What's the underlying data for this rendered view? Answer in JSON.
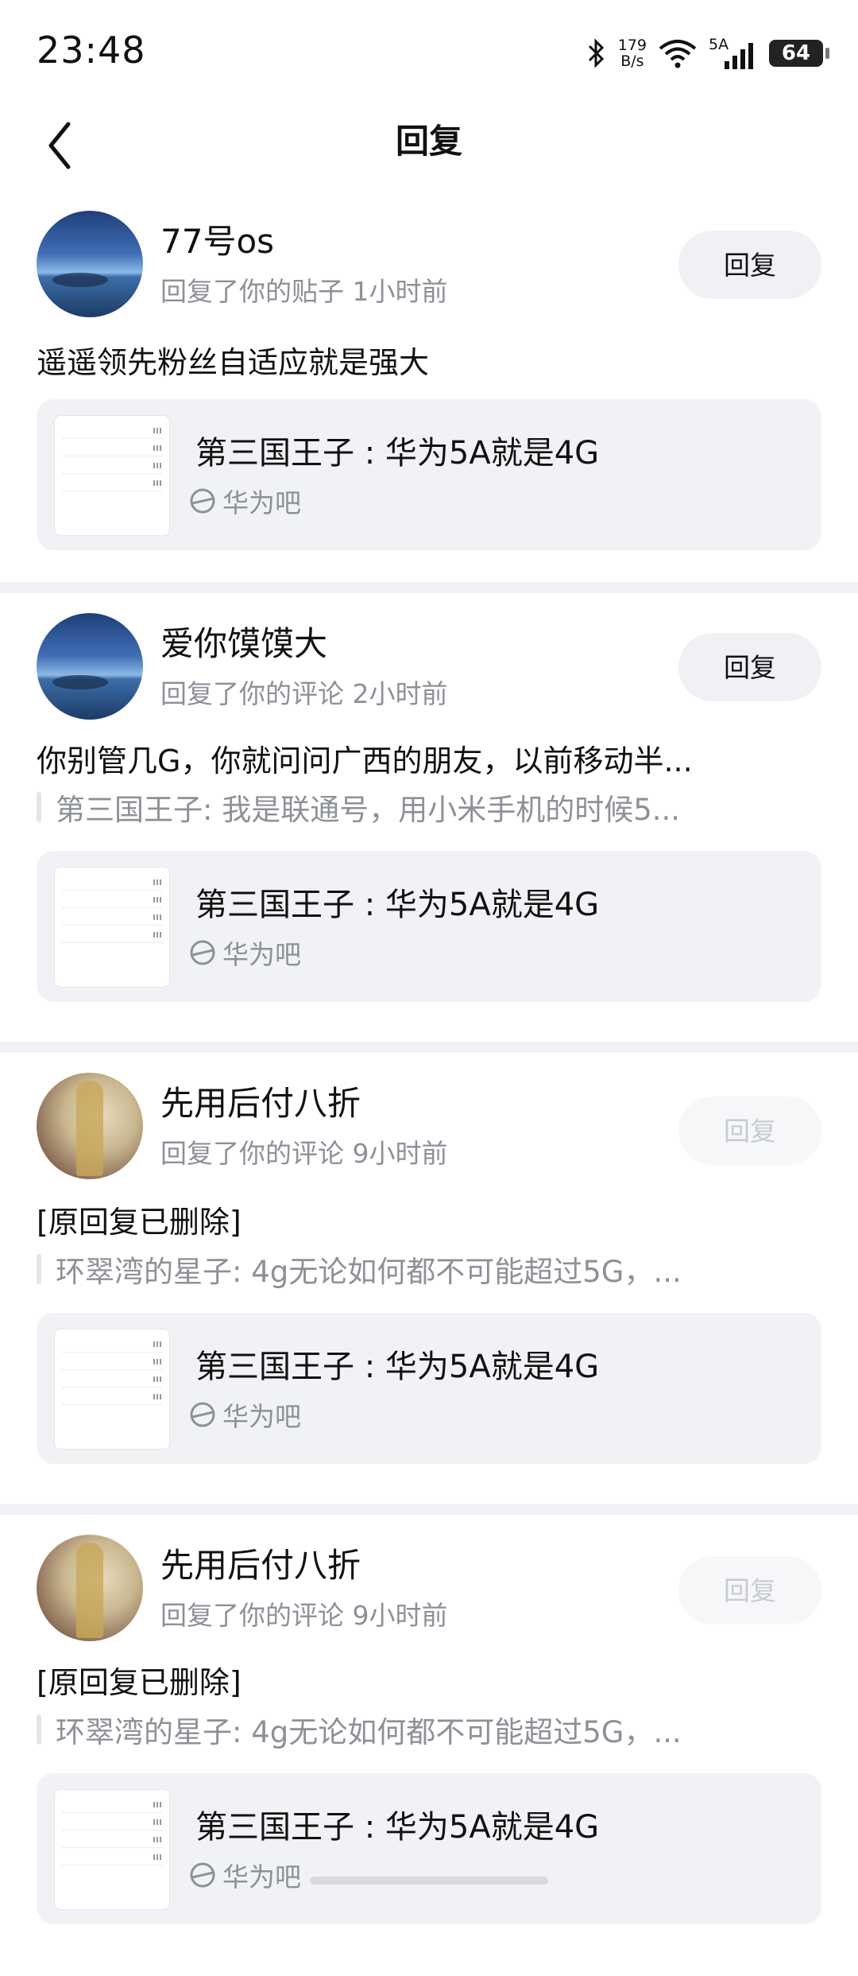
{
  "status": {
    "time": "23:48",
    "net_speed_top": "179",
    "net_speed_bottom": "B/s",
    "signal_label": "5A",
    "battery": "64"
  },
  "header": {
    "title": "回复"
  },
  "items": [
    {
      "name": "77号os",
      "meta": "回复了你的贴子 1小时前",
      "reply_label": "回复",
      "reply_enabled": true,
      "content": "遥遥领先粉丝自适应就是强大",
      "quote": "",
      "card": {
        "title": "第三国王子 : 华为5A就是4G",
        "forum": "华为吧"
      }
    },
    {
      "name": "爱你馍馍大",
      "meta": "回复了你的评论 2小时前",
      "reply_label": "回复",
      "reply_enabled": true,
      "content": "你别管几G，你就问问广西的朋友，以前移动半...",
      "quote": "第三国王子: 我是联通号，用小米手机的时候5...",
      "card": {
        "title": "第三国王子 : 华为5A就是4G",
        "forum": "华为吧"
      }
    },
    {
      "name": "先用后付八折",
      "meta": "回复了你的评论 9小时前",
      "reply_label": "回复",
      "reply_enabled": false,
      "content": "[原回复已删除]",
      "quote": "环翠湾的星子: 4g无论如何都不可能超过5G，...",
      "card": {
        "title": "第三国王子 : 华为5A就是4G",
        "forum": "华为吧"
      }
    },
    {
      "name": "先用后付八折",
      "meta": "回复了你的评论 9小时前",
      "reply_label": "回复",
      "reply_enabled": false,
      "content": "[原回复已删除]",
      "quote": "环翠湾的星子: 4g无论如何都不可能超过5G，...",
      "card": {
        "title": "第三国王子 : 华为5A就是4G",
        "forum": "华为吧"
      }
    }
  ]
}
